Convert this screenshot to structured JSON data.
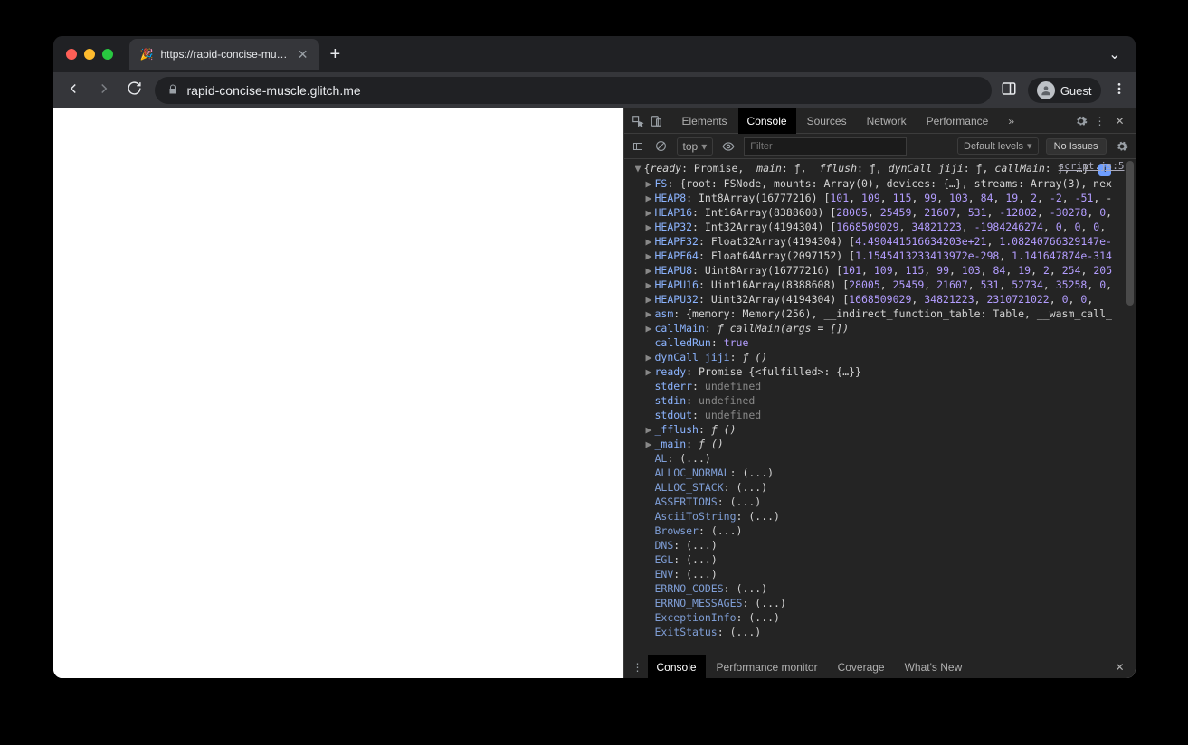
{
  "browser": {
    "tab_title": "https://rapid-concise-muscle.g",
    "url": "rapid-concise-muscle.glitch.me",
    "guest_label": "Guest"
  },
  "devtools": {
    "tabs": [
      "Elements",
      "Console",
      "Sources",
      "Network",
      "Performance"
    ],
    "active_tab": "Console",
    "more": "»",
    "subbar": {
      "context": "top",
      "filter_placeholder": "Filter",
      "levels": "Default levels",
      "issues": "No Issues"
    },
    "drawer": {
      "tabs": [
        "Console",
        "Performance monitor",
        "Coverage",
        "What's New"
      ],
      "active": "Console"
    },
    "source_link": "script.js:5",
    "object_summary": {
      "prefix": "{",
      "parts": [
        {
          "k": "ready",
          "v": "Promise"
        },
        {
          "k": "_main",
          "v": "ƒ"
        },
        {
          "k": "_fflush",
          "v": "ƒ"
        },
        {
          "k": "dynCall_jiji",
          "v": "ƒ"
        },
        {
          "k": "callMain",
          "v": "ƒ"
        }
      ],
      "suffix": ", …}"
    },
    "props": [
      {
        "arrow": true,
        "key": "FS",
        "rest": ": {root: FSNode, mounts: Array(0), devices: {…}, streams: Array(3), nex"
      },
      {
        "arrow": true,
        "key": "HEAP8",
        "rest": ": Int8Array(16777216) [",
        "nums": [
          101,
          109,
          115,
          99,
          103,
          84,
          19,
          2,
          -2,
          -51
        ],
        "tail": ", -"
      },
      {
        "arrow": true,
        "key": "HEAP16",
        "rest": ": Int16Array(8388608) [",
        "nums": [
          28005,
          25459,
          21607,
          531,
          -12802,
          -30278,
          0
        ],
        "tail": ","
      },
      {
        "arrow": true,
        "key": "HEAP32",
        "rest": ": Int32Array(4194304) [",
        "nums": [
          1668509029,
          34821223,
          -1984246274,
          0,
          0,
          0
        ],
        "tail": ", "
      },
      {
        "arrow": true,
        "key": "HEAPF32",
        "rest": ": Float32Array(4194304) [",
        "floats": [
          "4.490441516634203e+21",
          "1.08240766329147e-"
        ],
        "tail": ""
      },
      {
        "arrow": true,
        "key": "HEAPF64",
        "rest": ": Float64Array(2097152) [",
        "floats": [
          "1.1545413233413972e-298",
          "1.141647874e-314"
        ],
        "tail": ""
      },
      {
        "arrow": true,
        "key": "HEAPU8",
        "rest": ": Uint8Array(16777216) [",
        "nums": [
          101,
          109,
          115,
          99,
          103,
          84,
          19,
          2,
          254,
          205
        ],
        "tail": ""
      },
      {
        "arrow": true,
        "key": "HEAPU16",
        "rest": ": Uint16Array(8388608) [",
        "nums": [
          28005,
          25459,
          21607,
          531,
          52734,
          35258,
          0
        ],
        "tail": ","
      },
      {
        "arrow": true,
        "key": "HEAPU32",
        "rest": ": Uint32Array(4194304) [",
        "nums": [
          1668509029,
          34821223,
          2310721022,
          0,
          0
        ],
        "tail": ","
      },
      {
        "arrow": true,
        "key": "asm",
        "rest": ": {memory: Memory(256), __indirect_function_table: Table, __wasm_call_"
      },
      {
        "arrow": true,
        "key": "callMain",
        "rest": ": ",
        "func": "ƒ callMain(args = [])"
      },
      {
        "arrow": false,
        "key": "calledRun",
        "rest": ": ",
        "bool": "true"
      },
      {
        "arrow": true,
        "key": "dynCall_jiji",
        "rest": ": ",
        "func": "ƒ ()"
      },
      {
        "arrow": true,
        "key": "ready",
        "rest": ": Promise {<fulfilled>: {…}}"
      },
      {
        "arrow": false,
        "key": "stderr",
        "rest": ": undefined",
        "dimval": true
      },
      {
        "arrow": false,
        "key": "stdin",
        "rest": ": undefined",
        "dimval": true
      },
      {
        "arrow": false,
        "key": "stdout",
        "rest": ": undefined",
        "dimval": true
      },
      {
        "arrow": true,
        "key": "_fflush",
        "rest": ": ",
        "func": "ƒ ()"
      },
      {
        "arrow": true,
        "key": "_main",
        "rest": ": ",
        "func": "ƒ ()"
      },
      {
        "arrow": false,
        "dimkey": true,
        "key": "AL",
        "rest": ": (...)"
      },
      {
        "arrow": false,
        "dimkey": true,
        "key": "ALLOC_NORMAL",
        "rest": ": (...)"
      },
      {
        "arrow": false,
        "dimkey": true,
        "key": "ALLOC_STACK",
        "rest": ": (...)"
      },
      {
        "arrow": false,
        "dimkey": true,
        "key": "ASSERTIONS",
        "rest": ": (...)"
      },
      {
        "arrow": false,
        "dimkey": true,
        "key": "AsciiToString",
        "rest": ": (...)"
      },
      {
        "arrow": false,
        "dimkey": true,
        "key": "Browser",
        "rest": ": (...)"
      },
      {
        "arrow": false,
        "dimkey": true,
        "key": "DNS",
        "rest": ": (...)"
      },
      {
        "arrow": false,
        "dimkey": true,
        "key": "EGL",
        "rest": ": (...)"
      },
      {
        "arrow": false,
        "dimkey": true,
        "key": "ENV",
        "rest": ": (...)"
      },
      {
        "arrow": false,
        "dimkey": true,
        "key": "ERRNO_CODES",
        "rest": ": (...)"
      },
      {
        "arrow": false,
        "dimkey": true,
        "key": "ERRNO_MESSAGES",
        "rest": ": (...)"
      },
      {
        "arrow": false,
        "dimkey": true,
        "key": "ExceptionInfo",
        "rest": ": (...)"
      },
      {
        "arrow": false,
        "dimkey": true,
        "key": "ExitStatus",
        "rest": ": (...)"
      }
    ]
  }
}
